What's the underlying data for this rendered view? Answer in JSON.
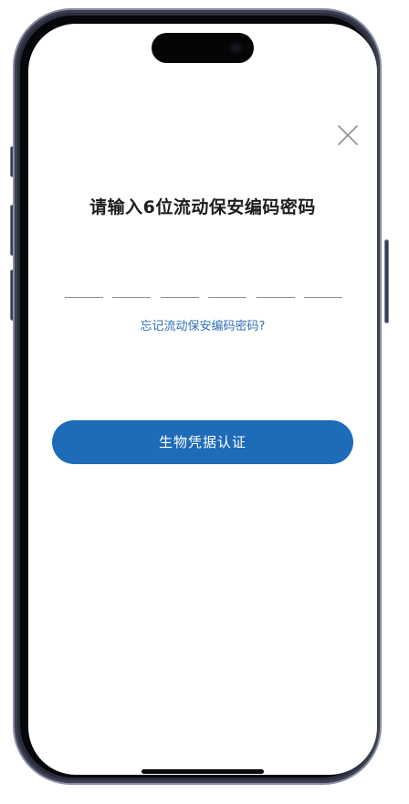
{
  "screen": {
    "title": "请输入6位流动保安编码密码",
    "pin": {
      "length": 6,
      "entered": ""
    },
    "forgot_link": "忘记流动保安编码密码?",
    "biometric_button": "生物凭据认证",
    "close_icon": "close-icon"
  },
  "colors": {
    "accent": "#1e6bb8",
    "link": "#2f6fb5",
    "title": "#1d1d1f",
    "background": "#ffffff"
  }
}
